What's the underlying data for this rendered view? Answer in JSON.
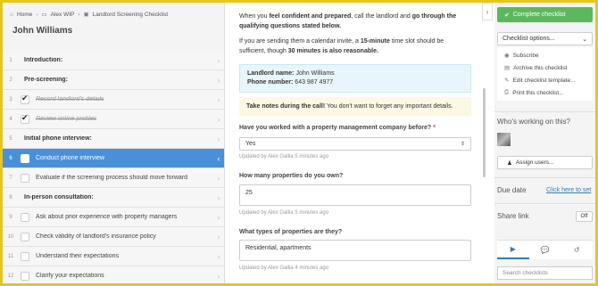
{
  "breadcrumb": {
    "home": "Home",
    "folder": "Alex WIP",
    "checklist": "Landlord Screening Checklist"
  },
  "checklist_title": "John Williams",
  "items": [
    {
      "num": "1",
      "label": "Introduction:",
      "type": "heading"
    },
    {
      "num": "2",
      "label": "Pre-screening:",
      "type": "heading"
    },
    {
      "num": "3",
      "label": "Record landlord's details",
      "type": "task",
      "done": true
    },
    {
      "num": "4",
      "label": "Review online profiles",
      "type": "task",
      "done": true
    },
    {
      "num": "5",
      "label": "Initial phone interview:",
      "type": "heading"
    },
    {
      "num": "6",
      "label": "Conduct phone interview",
      "type": "task",
      "active": true
    },
    {
      "num": "7",
      "label": "Evaluate if the screening process should move forward",
      "type": "task"
    },
    {
      "num": "8",
      "label": "In-person consultation:",
      "type": "heading"
    },
    {
      "num": "9",
      "label": "Ask about prior experience with property managers",
      "type": "task"
    },
    {
      "num": "10",
      "label": "Check validity of landlord's insurance policy",
      "type": "task"
    },
    {
      "num": "11",
      "label": "Understand their expectations",
      "type": "task"
    },
    {
      "num": "12",
      "label": "Clarify your expectations",
      "type": "task"
    }
  ],
  "content": {
    "intro_a": "When you ",
    "intro_b": "feel confident and prepared",
    "intro_c": ", call the landlord and ",
    "intro_d": "go through the qualifying questions stated below.",
    "invite_a": "If you are sending them a calendar invite, a ",
    "invite_b": "15-minute",
    "invite_c": " time slot should be sufficient, though ",
    "invite_d": "30 minutes is also reasonable.",
    "landlord_name_label": "Landlord name:",
    "landlord_name": "John Williams",
    "phone_label": "Phone number:",
    "phone": "643 987 4977",
    "notes_bold": "Take notes during the call!",
    "notes_rest": " You don't want to forget any important details.",
    "q1": "Have you worked with a property management company before?",
    "q1_required": "*",
    "q1_value": "Yes",
    "q1_updated": "Updated by Alex Gallia 5 minutes ago",
    "q2": "How many properties do you own?",
    "q2_value": "25",
    "q2_updated": "Updated by Alex Gallia 5 minutes ago",
    "q3": "What types of properties are they?",
    "q3_value": "Residential, apartments",
    "q3_updated": "Updated by Alex Gallia 4 minutes ago"
  },
  "sidebar": {
    "complete_label": "Complete checklist",
    "options_label": "Checklist options...",
    "menu": [
      {
        "icon": "eye-icon",
        "glyph": "◉",
        "label": "Subscribe"
      },
      {
        "icon": "archive-icon",
        "glyph": "▤",
        "label": "Archive this checklist"
      },
      {
        "icon": "pencil-icon",
        "glyph": "✎",
        "label": "Edit checklist template..."
      },
      {
        "icon": "print-icon",
        "glyph": "⎙",
        "label": "Print this checklist..."
      }
    ],
    "working_label": "Who's working on this?",
    "assign_label": "Assign users...",
    "due_label": "Due date",
    "due_link": "Click here to set",
    "share_label": "Share link",
    "share_toggle": "Off",
    "search_placeholder": "Search checklists"
  }
}
